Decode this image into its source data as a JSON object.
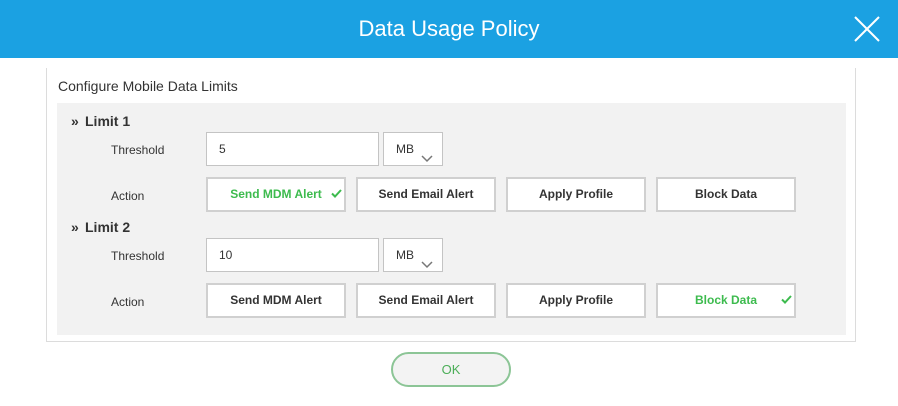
{
  "dialog": {
    "title": "Data Usage Policy",
    "section_title": "Configure Mobile Data Limits"
  },
  "limits": [
    {
      "heading": "Limit 1",
      "threshold_label": "Threshold",
      "threshold_value": "5",
      "unit": "MB",
      "action_label": "Action",
      "actions": [
        {
          "label": "Send MDM Alert",
          "selected": true
        },
        {
          "label": "Send Email Alert",
          "selected": false
        },
        {
          "label": "Apply Profile",
          "selected": false
        },
        {
          "label": "Block Data",
          "selected": false
        }
      ]
    },
    {
      "heading": "Limit 2",
      "threshold_label": "Threshold",
      "threshold_value": "10",
      "unit": "MB",
      "action_label": "Action",
      "actions": [
        {
          "label": "Send MDM Alert",
          "selected": false
        },
        {
          "label": "Send Email Alert",
          "selected": false
        },
        {
          "label": "Apply Profile",
          "selected": false
        },
        {
          "label": "Block Data",
          "selected": true
        }
      ]
    }
  ],
  "footer": {
    "ok_label": "OK"
  },
  "colors": {
    "header": "#1ba1e2",
    "selected_text": "#3dbb4e",
    "ok_border": "#8cc596"
  }
}
